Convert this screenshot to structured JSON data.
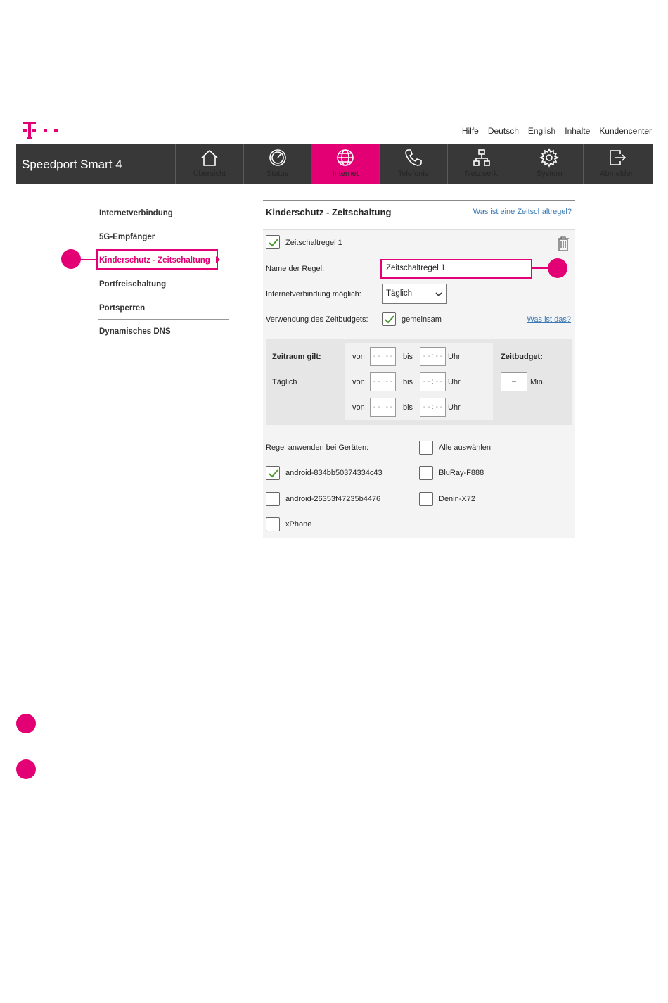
{
  "brand_color": "#e20074",
  "logo": {
    "icon": "telekom-logo-icon"
  },
  "topnav": [
    "Hilfe",
    "Deutsch",
    "English",
    "Inhalte",
    "Kundencenter"
  ],
  "header": {
    "title": "Speedport Smart 4",
    "nav": [
      {
        "label": "Übersicht",
        "icon": "home-icon",
        "active": false
      },
      {
        "label": "Status",
        "icon": "gauge-icon",
        "active": false
      },
      {
        "label": "Internet",
        "icon": "globe-icon",
        "active": true
      },
      {
        "label": "Telefonie",
        "icon": "phone-icon",
        "active": false
      },
      {
        "label": "Netzwerk",
        "icon": "network-icon",
        "active": false
      },
      {
        "label": "System",
        "icon": "gear-icon",
        "active": false
      },
      {
        "label": "Abmelden",
        "icon": "logout-icon",
        "active": false
      }
    ]
  },
  "sidebar": {
    "items": [
      {
        "label": "Internetverbindung",
        "active": false
      },
      {
        "label": "5G-Empfänger",
        "active": false
      },
      {
        "label": "Kinderschutz - Zeitschaltung",
        "active": true
      },
      {
        "label": "Portfreischaltung",
        "active": false
      },
      {
        "label": "Portsperren",
        "active": false
      },
      {
        "label": "Dynamisches DNS",
        "active": false
      }
    ]
  },
  "panel": {
    "title": "Kinderschutz - Zeitschaltung",
    "help_link": "Was ist eine Zeitschaltregel?",
    "rule_checkbox_label": "Zeitschaltregel 1",
    "rule_checked": true,
    "name_label": "Name der Regel:",
    "name_value": "Zeitschaltregel 1",
    "internet_label": "Internetverbindung möglich:",
    "internet_value": "Täglich",
    "budget_usage_label": "Verwendung des Zeitbudgets:",
    "budget_usage_option": "gemeinsam",
    "budget_usage_checked": true,
    "budget_help_link": "Was ist das?",
    "time": {
      "period_label": "Zeitraum gilt:",
      "period_value": "Täglich",
      "from_label": "von",
      "to_label": "bis",
      "unit_label": "Uhr",
      "placeholder": "- - : - -",
      "budget_label": "Zeitbudget:",
      "budget_value": "–",
      "budget_unit": "Min."
    },
    "devices_label": "Regel anwenden bei Geräten:",
    "select_all_label": "Alle auswählen",
    "devices": [
      {
        "label": "android-834bb50374334c43",
        "checked": true
      },
      {
        "label": "BluRay-F888",
        "checked": false
      },
      {
        "label": "android-26353f47235b4476",
        "checked": false
      },
      {
        "label": "Denin-X72",
        "checked": false
      },
      {
        "label": "xPhone",
        "checked": false
      }
    ]
  }
}
